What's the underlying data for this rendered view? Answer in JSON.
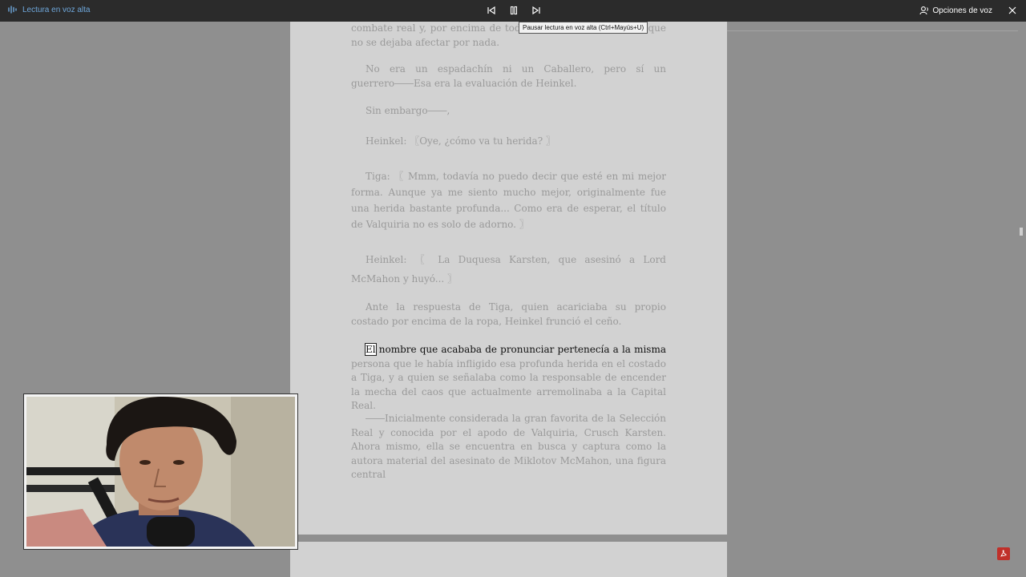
{
  "toolbar": {
    "read_aloud_label": "Lectura en voz alta",
    "voice_options_label": "Opciones de voz",
    "pause_tooltip": "Pausar lectura en voz alta (Ctrl+Mayús+U)",
    "icons": {
      "read_aloud": "audio-wave-icon",
      "previous": "skip-previous-icon",
      "pause": "pause-icon",
      "next": "skip-next-icon",
      "voice_options": "voice-person-icon",
      "close": "close-icon"
    }
  },
  "document": {
    "paragraphs": [
      "combate real y, por encima de todo, de la clase de persona que no se dejaba afectar por nada.",
      "No era un espadachín ni un Caballero, pero sí un guerrero――Esa era la evaluación de Heinkel.",
      "Sin embargo――,",
      "Heinkel: 〖Oye, ¿cómo va tu herida? 〗",
      "Tiga: 〖 Mmm, todavía no puedo decir que esté en mi mejor forma. Aunque ya me siento mucho mejor, originalmente fue una herida bastante profunda... Como era de esperar, el título de Valquiria no es solo de adorno. 〗",
      "Heinkel: 〖 La Duquesa Karsten, que asesinó a Lord McMahon y huyó... 〗",
      "Ante la respuesta de Tiga, quien acariciaba su propio costado por encima de la ropa, Heinkel frunció el ceño."
    ],
    "active_paragraph": {
      "highlighted_word": "El",
      "highlighted_rest": " nombre que acababa de pronunciar pertenecía a la misma",
      "remainder": "persona que le había infligido esa profunda herida en el costado a Tiga, y a quien se señalaba como la responsable de encender la mecha del caos que actualmente arremolinaba a la Capital Real."
    },
    "last_paragraph": "――Inicialmente considerada la gran favorita de la Selección Real y conocida por el apodo de Valquiria, Crusch Karsten. Ahora mismo, ella se encuentra en busca y captura como la autora material del asesinato de Miklotov McMahon, una figura central"
  },
  "colors": {
    "toolbar_bg": "#2b2b2b",
    "accent": "#6fa8dc",
    "page_bg": "#d2d2d2",
    "canvas_bg": "#8f8f8f",
    "pdf_red": "#c0302a"
  }
}
